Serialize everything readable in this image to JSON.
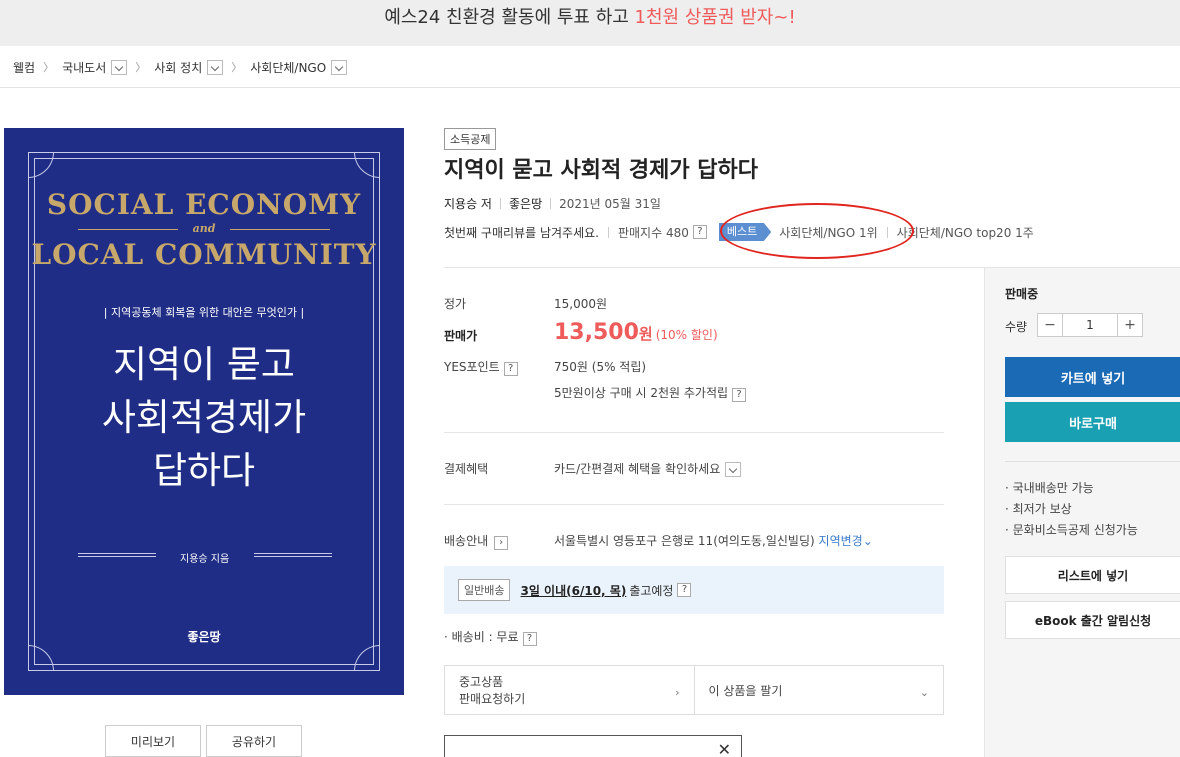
{
  "banner": {
    "text_pre": "예스24 친환경 활동에 투표 하고 ",
    "text_hl": "1천원 상품권 받자~!"
  },
  "breadcrumb": [
    "웰컴",
    "국내도서",
    "사회 정치",
    "사회단체/NGO"
  ],
  "cover": {
    "en_line1": "SOCIAL ECONOMY",
    "en_and": "and",
    "en_line2": "LOCAL COMMUNITY",
    "subtitle": "| 지역공동체 회복을 위한 대안은 무엇인가 |",
    "title_lines": [
      "지역이 묻고",
      "사회적경제가",
      "답하다"
    ],
    "author": "지용승 지음",
    "publisher": "좋은땅"
  },
  "cover_buttons": {
    "preview": "미리보기",
    "share": "공유하기"
  },
  "product": {
    "tag": "소득공제",
    "title": "지역이 묻고 사회적 경제가 답하다",
    "author": "지용승 저",
    "publisher": "좋은땅",
    "date": "2021년 05월 31일",
    "review_prompt": "첫번째 구매리뷰를 남겨주세요.",
    "sales_index": "판매지수 480",
    "best_badge": "베스트",
    "rank1": "사회단체/NGO 1위",
    "rank2": "사회단체/NGO top20 1주"
  },
  "price": {
    "list_label": "정가",
    "list_value": "15,000원",
    "sale_label": "판매가",
    "sale_value": "13,500",
    "sale_unit": "원",
    "discount": "(10% 할인)",
    "point_label": "YES포인트",
    "point_value": "750원 (5% 적립)",
    "extra_point": "5만원이상 구매 시 2천원 추가적립"
  },
  "payment": {
    "label": "결제혜택",
    "value": "카드/간편결제 혜택을 확인하세요"
  },
  "shipping": {
    "label": "배송안내",
    "address": "서울특별시 영등포구 은행로 11(여의도동,일신빌딩)",
    "change": "지역변경",
    "type_chip": "일반배송",
    "eta": "3일 이내(6/10, 목)",
    "eta_suffix": "출고예정",
    "fee": "· 배송비 : 무료"
  },
  "used": {
    "request_line1": "중고상품",
    "request_line2": "판매요청하기",
    "sell": "이 상품을 팔기"
  },
  "side": {
    "status": "판매중",
    "qty_label": "수량",
    "qty": "1",
    "minus": "−",
    "plus": "+",
    "cart": "카트에 넣기",
    "buy": "바로구매",
    "info": [
      "· 국내배송만 가능",
      "· 최저가 보상",
      "· 문화비소득공제 신청가능"
    ],
    "wishlist": "리스트에 넣기",
    "ebook": "eBook 출간 알림신청"
  },
  "help_glyph": "?",
  "close_glyph": "✕",
  "chevron_right": "›",
  "chevron_down": "⌄",
  "colors": {
    "accent_red": "#ef5b5b",
    "cart_blue": "#1b6ab5",
    "buy_teal": "#1aa0b3",
    "best_blue": "#5b8fd1",
    "cover_navy": "#1f2d86",
    "cover_gold": "#c8a86a"
  }
}
